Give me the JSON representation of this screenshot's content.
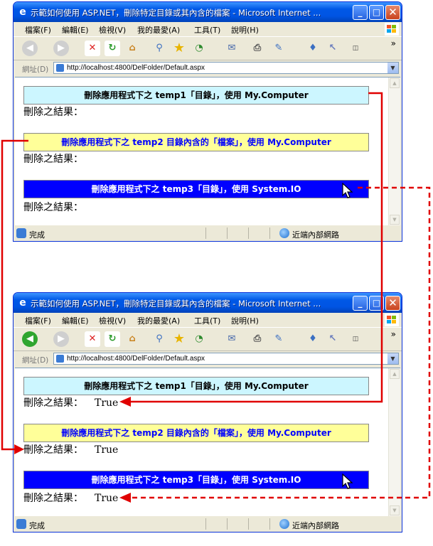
{
  "window": {
    "title": "示範如何使用 ASP.NET，刪除特定目錄或其內含的檔案 - Microsoft Internet ...",
    "menu": [
      "檔案(F)",
      "編輯(E)",
      "檢視(V)",
      "我的最愛(A)",
      "工具(T)",
      "說明(H)"
    ],
    "address_label": "網址(D)",
    "url": "http://localhost:4800/DelFolder/Default.aspx",
    "status": "完成",
    "zone": "近端內部網路",
    "toolbar_more": "»"
  },
  "buttons": {
    "btn1": "刪除應用程式下之  temp1「目錄」，使用  My.Computer",
    "btn2": "刪除應用程式下之  temp2 目錄內含的「檔案」，使用  My.Computer",
    "btn3": "刪除應用程式下之  temp3「目錄」，使用  System.IO"
  },
  "result_label": "刪除之結果：",
  "after": {
    "r1": "True",
    "r2": "True",
    "r3": "True"
  },
  "colors": {
    "arrow": "#E00000",
    "btn1_bg": "#CCF6FF",
    "btn2_bg": "#FFFF99",
    "btn2_fg": "#0000FF",
    "btn3_bg": "#0000FF"
  }
}
